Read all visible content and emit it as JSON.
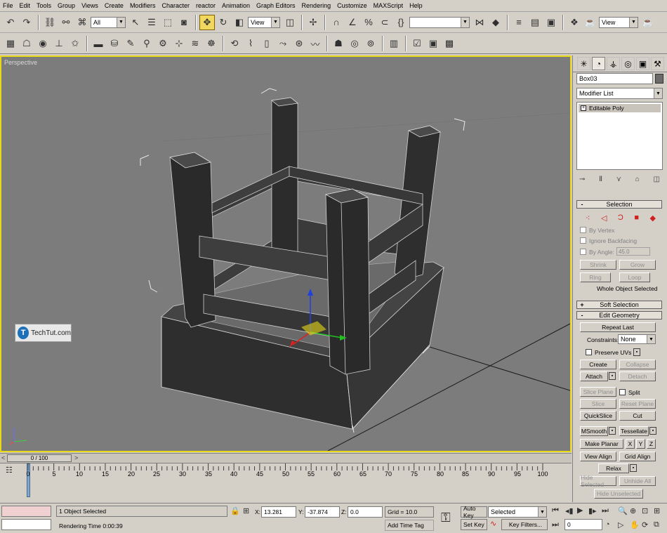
{
  "menu": [
    "File",
    "Edit",
    "Tools",
    "Group",
    "Views",
    "Create",
    "Modifiers",
    "Character",
    "reactor",
    "Animation",
    "Graph Editors",
    "Rendering",
    "Customize",
    "MAXScript",
    "Help"
  ],
  "toolbar1": {
    "selection_filter": "All",
    "ref_coord": "View",
    "named_selection": "",
    "render_dropdown": "View"
  },
  "viewport": {
    "label": "Perspective",
    "watermark_text": "TechTut.com",
    "watermark_logo": "T"
  },
  "command_panel": {
    "object_name": "Box03",
    "modifier_list_label": "Modifier List",
    "stack_item": "Editable Poly",
    "selection": {
      "title": "Selection",
      "by_vertex": "By Vertex",
      "ignore_backfacing": "Ignore Backfacing",
      "by_angle": "By Angle:",
      "by_angle_value": "45.0",
      "shrink": "Shrink",
      "grow": "Grow",
      "ring": "Ring",
      "loop": "Loop",
      "status": "Whole Object Selected"
    },
    "soft_selection": {
      "title": "Soft Selection"
    },
    "edit_geometry": {
      "title": "Edit Geometry",
      "repeat_last": "Repeat Last",
      "constraints_label": "Constraints:",
      "constraints_value": "None",
      "preserve_uvs": "Preserve UVs",
      "create": "Create",
      "collapse": "Collapse",
      "attach": "Attach",
      "detach": "Detach",
      "slice_plane": "Slice Plane",
      "split": "Split",
      "slice": "Slice",
      "reset_plane": "Reset Plane",
      "quickslice": "QuickSlice",
      "cut": "Cut",
      "msmooth": "MSmooth",
      "tessellate": "Tessellate",
      "make_planar": "Make Planar",
      "x": "X",
      "y": "Y",
      "z": "Z",
      "view_align": "View Align",
      "grid_align": "Grid Align",
      "relax": "Relax",
      "hide_selected": "Hide Selected",
      "unhide_all": "Unhide All",
      "hide_unselected": "Hide Unselected"
    }
  },
  "timeline": {
    "slider_label": "0 / 100",
    "ticks": [
      "0",
      "5",
      "10",
      "15",
      "20",
      "25",
      "30",
      "35",
      "40",
      "45",
      "50",
      "55",
      "60",
      "65",
      "70",
      "75",
      "80",
      "85",
      "90",
      "95",
      "100"
    ]
  },
  "status": {
    "selection_count": "1 Object Selected",
    "rendering_time": "Rendering Time  0:00:39",
    "x_label": "X:",
    "x_value": "13.281",
    "y_label": "Y:",
    "y_value": "-37.874",
    "z_label": "Z:",
    "z_value": "0.0",
    "grid": "Grid = 10.0",
    "add_time_tag": "Add Time Tag",
    "auto_key": "Auto Key",
    "set_key": "Set Key",
    "key_mode": "Selected",
    "key_filters": "Key Filters...",
    "frame": "0"
  }
}
